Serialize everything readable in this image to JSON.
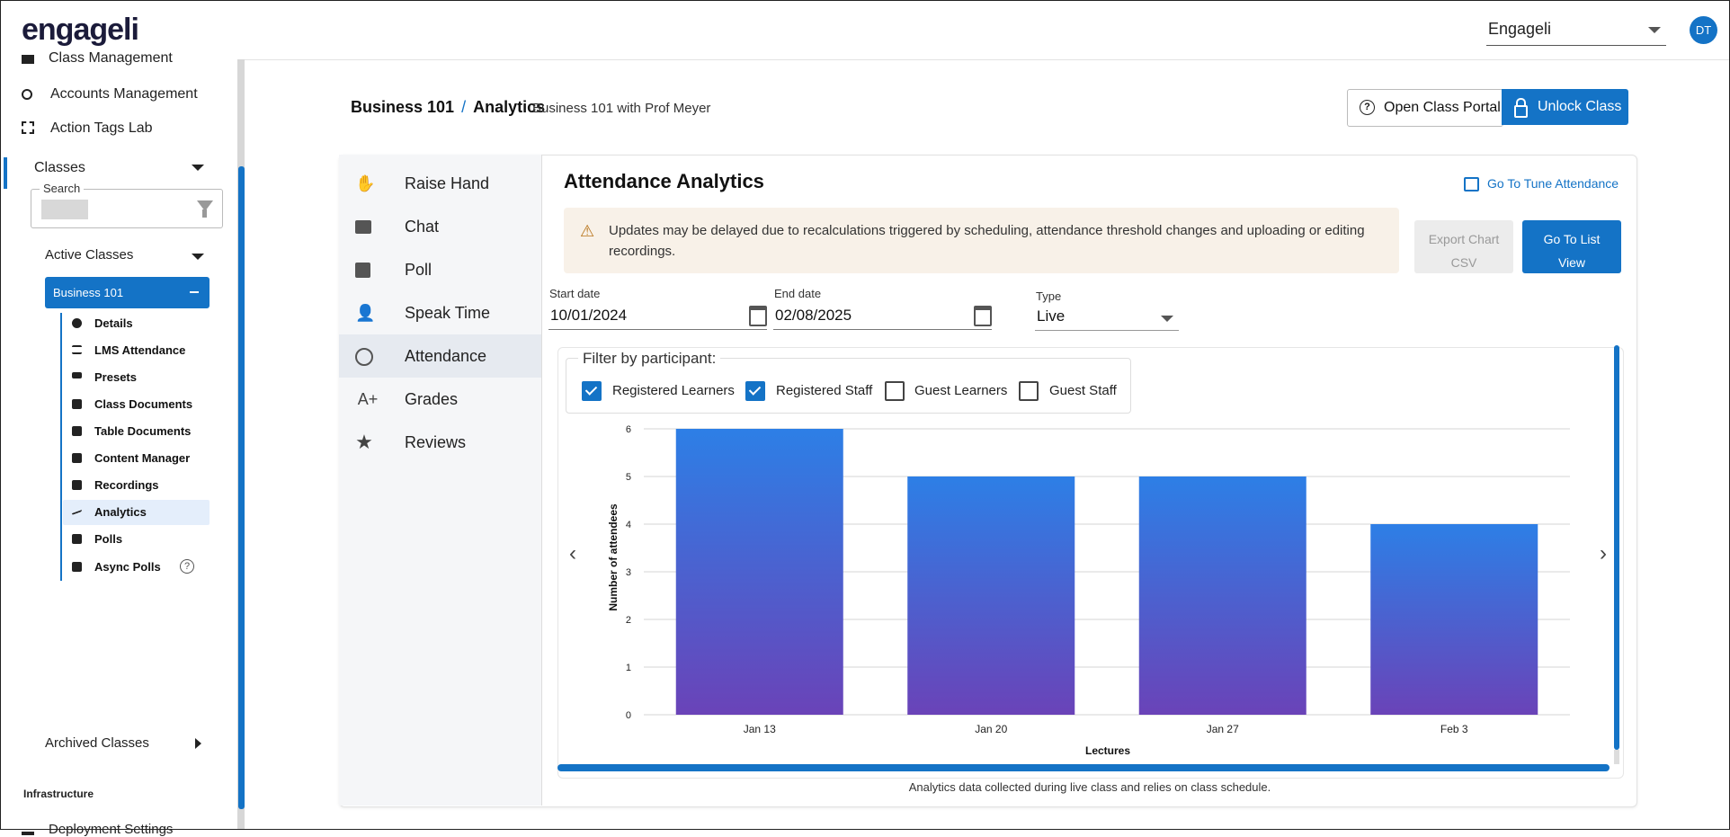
{
  "header": {
    "logo": "engageli",
    "org_select": "Engageli",
    "avatar": "DT"
  },
  "sidebar": {
    "items": [
      {
        "label": "Class Management",
        "icon": "folder-icon"
      },
      {
        "label": "Accounts Management",
        "icon": "accounts-icon"
      },
      {
        "label": "Action Tags Lab",
        "icon": "tags-icon"
      }
    ],
    "classes_label": "Classes",
    "search_label": "Search",
    "active_classes_label": "Active Classes",
    "selected_class": "Business 101",
    "sub_items": [
      {
        "label": "Details",
        "icon": "info-icon"
      },
      {
        "label": "LMS Attendance",
        "icon": "list-icon"
      },
      {
        "label": "Presets",
        "icon": "presets-icon"
      },
      {
        "label": "Class Documents",
        "icon": "documents-icon"
      },
      {
        "label": "Table Documents",
        "icon": "document-icon"
      },
      {
        "label": "Content Manager",
        "icon": "gallery-icon"
      },
      {
        "label": "Recordings",
        "icon": "video-icon"
      },
      {
        "label": "Analytics",
        "icon": "trend-icon"
      },
      {
        "label": "Polls",
        "icon": "poll-icon"
      },
      {
        "label": "Async Polls",
        "icon": "poll-icon"
      }
    ],
    "archived_label": "Archived Classes",
    "infrastructure_label": "Infrastructure",
    "deployment_label": "Deployment Settings"
  },
  "breadcrumb": {
    "course": "Business 101",
    "separator": "/",
    "page": "Analytics",
    "subtitle": "Business 101 with Prof Meyer"
  },
  "actions": {
    "open_portal": "Open Class Portal",
    "unlock": "Unlock Class"
  },
  "analytics_nav": [
    {
      "label": "Raise Hand",
      "icon": "hand-icon"
    },
    {
      "label": "Chat",
      "icon": "chat-icon"
    },
    {
      "label": "Poll",
      "icon": "poll-chart-icon"
    },
    {
      "label": "Speak Time",
      "icon": "speak-icon"
    },
    {
      "label": "Attendance",
      "icon": "clock-icon"
    },
    {
      "label": "Grades",
      "icon": "grades-icon"
    },
    {
      "label": "Reviews",
      "icon": "star-icon"
    }
  ],
  "attendance": {
    "title": "Attendance Analytics",
    "tune_link": "Go To Tune Attendance",
    "warning": "Updates may be delayed due to recalculations triggered by scheduling, attendance threshold changes and uploading or editing recordings.",
    "export_line1": "Export Chart",
    "export_line2": "CSV",
    "list_line1": "Go To List",
    "list_line2": "View",
    "start_label": "Start date",
    "start_value": "10/01/2024",
    "end_label": "End date",
    "end_value": "02/08/2025",
    "type_label": "Type",
    "type_value": "Live",
    "filter_legend": "Filter by participant:",
    "filters": [
      {
        "label": "Registered Learners",
        "checked": true
      },
      {
        "label": "Registered Staff",
        "checked": true
      },
      {
        "label": "Guest Learners",
        "checked": false
      },
      {
        "label": "Guest Staff",
        "checked": false
      }
    ],
    "note": "Analytics data collected during live class and relies on class schedule."
  },
  "chart_data": {
    "type": "bar",
    "categories": [
      "Jan 13",
      "Jan 20",
      "Jan 27",
      "Feb 3"
    ],
    "values": [
      6,
      5,
      5,
      4
    ],
    "xlabel": "Lectures",
    "ylabel": "Number of attendees",
    "ylim": [
      0,
      6
    ],
    "yticks": [
      "0",
      "1",
      "2",
      "3",
      "4",
      "5",
      "6"
    ],
    "grid": true,
    "bar_gradient": [
      "#2d7fe6",
      "#6a43b8"
    ]
  },
  "colors": {
    "accent": "#1473c6"
  }
}
